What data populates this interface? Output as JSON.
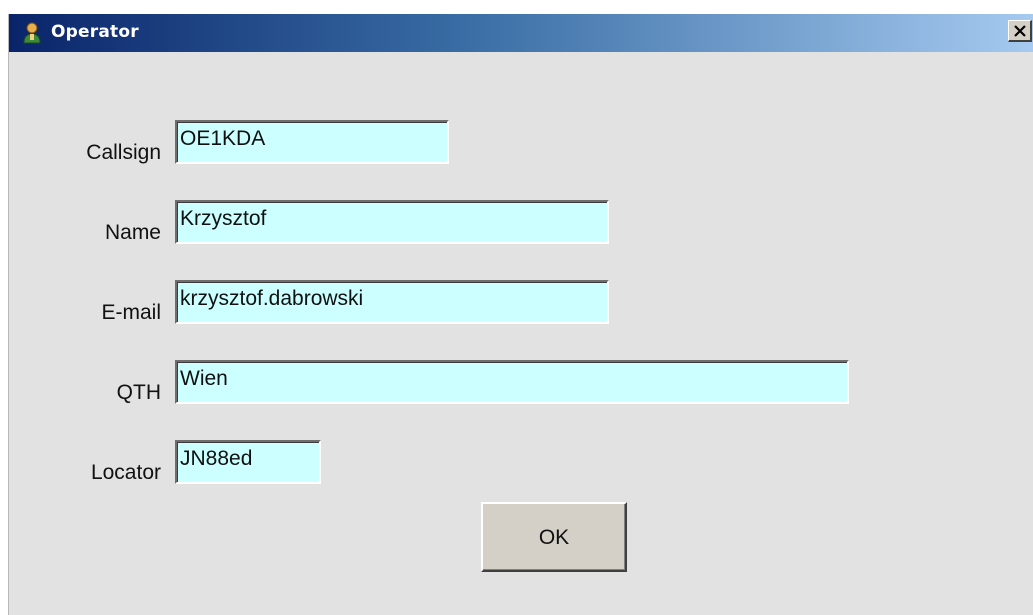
{
  "window": {
    "title": "Operator",
    "title_icon": "person-icon",
    "close_icon": "close-icon"
  },
  "form": {
    "fields": [
      {
        "label": "Callsign",
        "value": "OE1KDA"
      },
      {
        "label": "Name",
        "value": "Krzysztof"
      },
      {
        "label": "E-mail",
        "value": "krzysztof.dabrowski"
      },
      {
        "label": "QTH",
        "value": "Wien"
      },
      {
        "label": "Locator",
        "value": "JN88ed"
      }
    ],
    "field_background": "#ccffff",
    "ok_label": "OK"
  }
}
